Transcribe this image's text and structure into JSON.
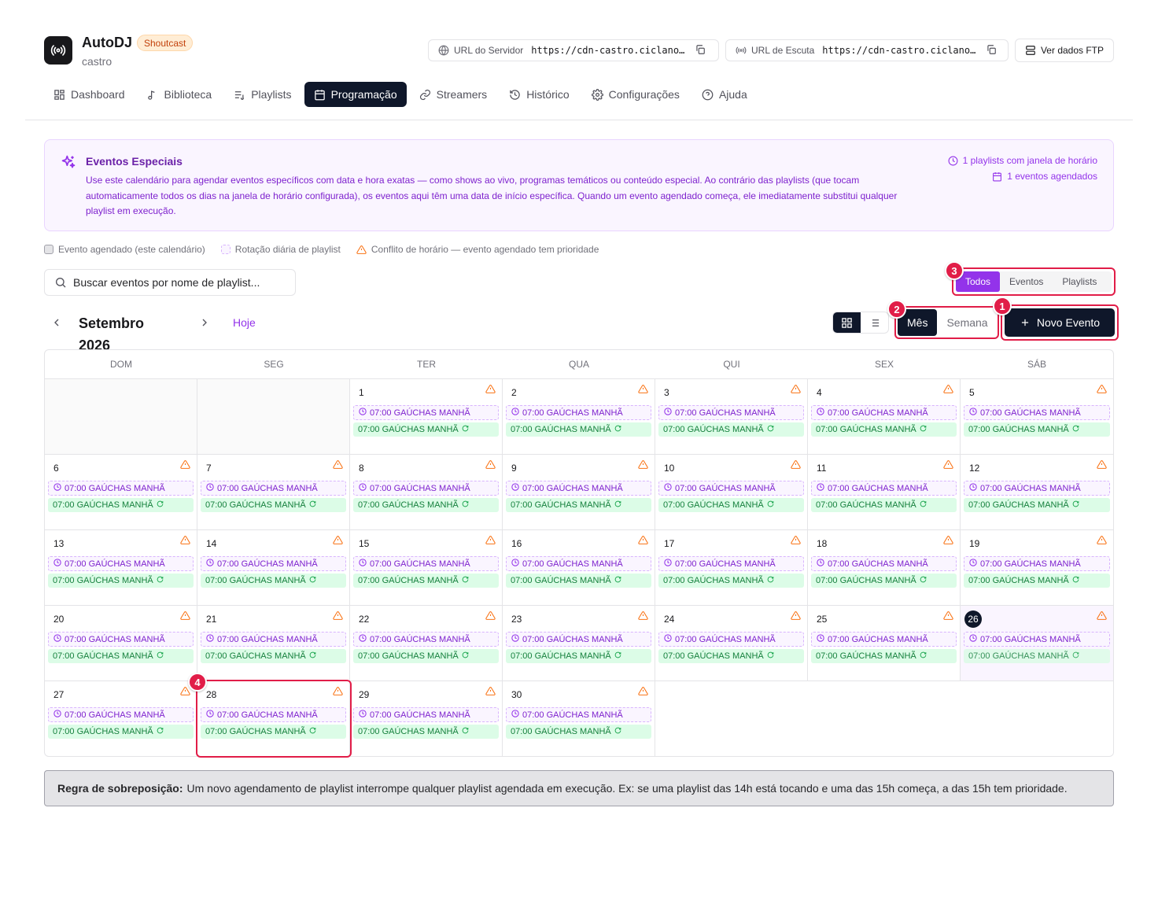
{
  "app": {
    "name": "AutoDJ",
    "badge": "Shoutcast",
    "subtitle": "castro",
    "server_url_label": "URL do Servidor",
    "server_url": "https://cdn-castro.ciclano…",
    "listen_url_label": "URL de Escuta",
    "listen_url": "https://cdn-castro.ciclano…",
    "ftp_button": "Ver dados FTP"
  },
  "nav": [
    {
      "label": "Dashboard",
      "icon": "dashboard-icon"
    },
    {
      "label": "Biblioteca",
      "icon": "music-note-icon"
    },
    {
      "label": "Playlists",
      "icon": "playlist-icon"
    },
    {
      "label": "Programação",
      "icon": "calendar-icon",
      "active": true
    },
    {
      "label": "Streamers",
      "icon": "link-icon"
    },
    {
      "label": "Histórico",
      "icon": "history-icon"
    },
    {
      "label": "Configurações",
      "icon": "gear-icon"
    },
    {
      "label": "Ajuda",
      "icon": "help-icon"
    }
  ],
  "info": {
    "title": "Eventos Especiais",
    "text": "Use este calendário para agendar eventos específicos com data e hora exatas — como shows ao vivo, programas temáticos ou conteúdo especial. Ao contrário das playlists (que tocam automaticamente todos os dias na janela de horário configurada), os eventos aqui têm uma data de início específica. Quando um evento agendado começa, ele imediatamente substitui qualquer playlist em execução.",
    "stat_playlists": "1 playlists com janela de horário",
    "stat_events": "1 eventos agendados"
  },
  "legend": {
    "scheduled": "Evento agendado (este calendário)",
    "rotation": "Rotação diária de playlist",
    "conflict": "Conflito de horário — evento agendado tem prioridade"
  },
  "search": {
    "placeholder": "Buscar eventos por nome de playlist..."
  },
  "filter": {
    "todos": "Todos",
    "eventos": "Eventos",
    "playlists": "Playlists"
  },
  "toolbar": {
    "month": "Setembro 2026",
    "today": "Hoje",
    "mode_month": "Mês",
    "mode_week": "Semana",
    "new_event": "Novo Evento"
  },
  "markers": {
    "m1": "1",
    "m2": "2",
    "m3": "3",
    "m4": "4"
  },
  "calendar": {
    "weekdays": [
      "DOM",
      "SEG",
      "TER",
      "QUA",
      "QUI",
      "SEX",
      "SÁB"
    ],
    "lead_empty": 2,
    "days_in_month": 30,
    "today": 26,
    "event_label": "07:00 GAÚCHAS MANHÃ",
    "playlist_label": "07:00 GAÚCHAS MANHÃ"
  },
  "rule": {
    "title": "Regra de sobreposição:",
    "text": "Um novo agendamento de playlist interrompe qualquer playlist agendada em execução. Ex: se uma playlist das 14h está tocando e uma das 15h começa, a das 15h tem prioridade."
  },
  "colors": {
    "accent": "#9333ea",
    "dark": "#0f172a",
    "highlight": "#e11d48",
    "warning": "#f97316",
    "playlist": "#15803d"
  }
}
